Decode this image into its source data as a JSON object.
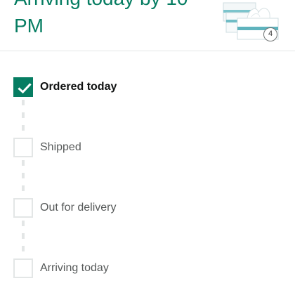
{
  "header": {
    "arrival_title": "Arriving today by 10 PM",
    "product_image": "tissue-box-pack",
    "quantity": "4"
  },
  "tracker": {
    "steps": [
      {
        "label": "Ordered today",
        "completed": true
      },
      {
        "label": "Shipped",
        "completed": false
      },
      {
        "label": "Out for delivery",
        "completed": false
      },
      {
        "label": "Arriving today",
        "completed": false
      }
    ]
  },
  "colors": {
    "accent": "#067d62",
    "pending": "#e3e6e6",
    "text_primary": "#0f1111",
    "text_secondary": "#565959"
  },
  "icons": {
    "completed_step": "checkmark-icon"
  }
}
